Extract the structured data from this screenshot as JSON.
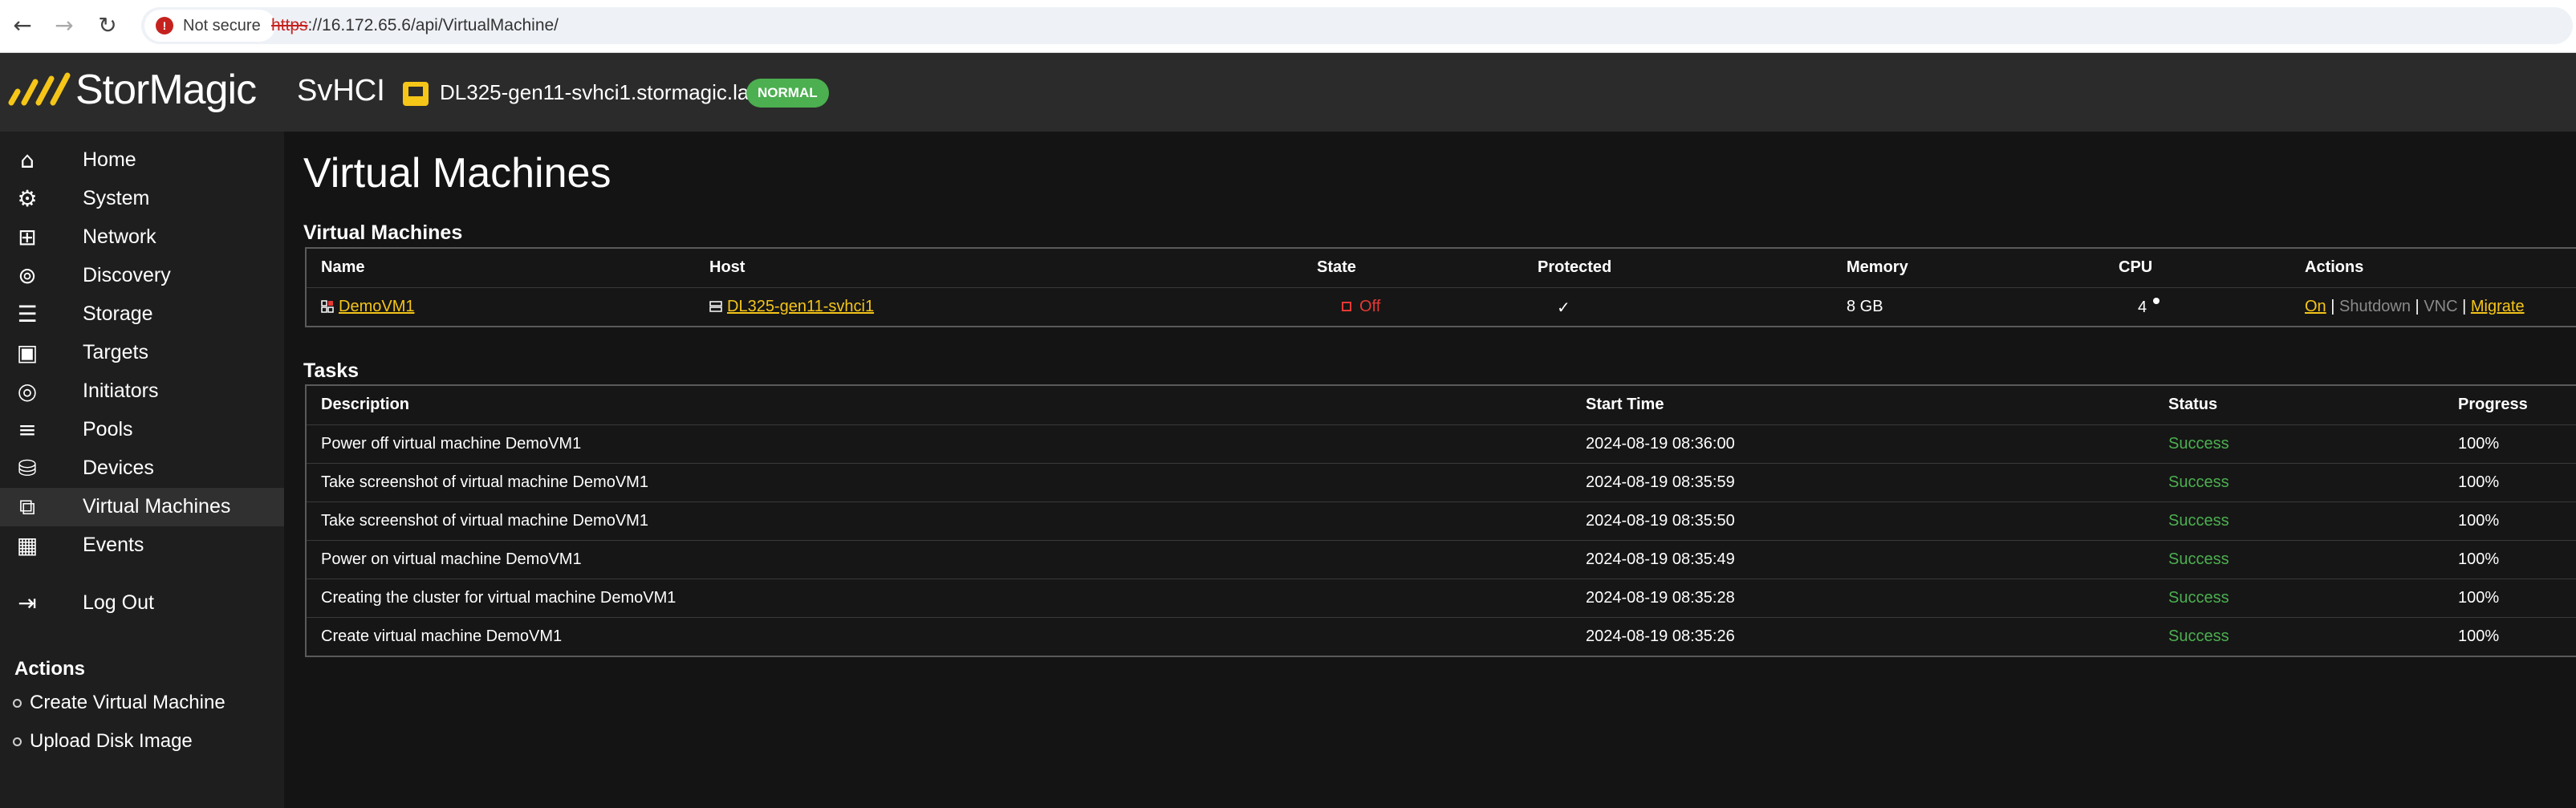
{
  "browser": {
    "back_icon": "arrow-left-icon",
    "forward_icon": "arrow-right-icon",
    "reload_icon": "reload-icon",
    "security_label": "Not secure",
    "url_scheme": "https",
    "url_rest": "://16.172.65.6/api/VirtualMachine/"
  },
  "header": {
    "logo_text": "StorMagic",
    "product": "SvHCI",
    "host_name": "DL325-gen11-svhci1.stormagic.lab",
    "status": "NORMAL",
    "brand_color": "#f5c518",
    "status_color": "#4caf50"
  },
  "sidebar": {
    "items": [
      {
        "label": "Home",
        "icon": "home-icon"
      },
      {
        "label": "System",
        "icon": "system-icon"
      },
      {
        "label": "Network",
        "icon": "network-icon"
      },
      {
        "label": "Discovery",
        "icon": "discovery-icon"
      },
      {
        "label": "Storage",
        "icon": "storage-icon"
      },
      {
        "label": "Targets",
        "icon": "targets-icon"
      },
      {
        "label": "Initiators",
        "icon": "initiators-icon"
      },
      {
        "label": "Pools",
        "icon": "pools-icon"
      },
      {
        "label": "Devices",
        "icon": "devices-icon"
      },
      {
        "label": "Virtual Machines",
        "icon": "virtual-machines-icon",
        "active": true
      },
      {
        "label": "Events",
        "icon": "events-icon"
      },
      {
        "label": "Log Out",
        "icon": "logout-icon"
      }
    ],
    "actions_title": "Actions",
    "actions": [
      "Create Virtual Machine",
      "Upload Disk Image"
    ]
  },
  "main": {
    "title": "Virtual Machines",
    "vm_section_title": "Virtual Machines",
    "vm_columns": [
      "Name",
      "Host",
      "State",
      "Protected",
      "Memory",
      "CPU",
      "Actions"
    ],
    "vm_rows": [
      {
        "name": "DemoVM1",
        "host": "DL325-gen11-svhci1",
        "state": "Off",
        "protected": "✓",
        "memory": "8 GB",
        "cpu": "4",
        "actions": {
          "on": "On",
          "shutdown": "Shutdown",
          "vnc": "VNC",
          "migrate": "Migrate",
          "sep": "|"
        }
      }
    ],
    "tasks_section_title": "Tasks",
    "task_columns": [
      "Description",
      "Start Time",
      "Status",
      "Progress"
    ],
    "task_rows": [
      {
        "description": "Power off virtual machine DemoVM1",
        "start": "2024-08-19 08:36:00",
        "status": "Success",
        "progress": "100%"
      },
      {
        "description": "Take screenshot of virtual machine DemoVM1",
        "start": "2024-08-19 08:35:59",
        "status": "Success",
        "progress": "100%"
      },
      {
        "description": "Take screenshot of virtual machine DemoVM1",
        "start": "2024-08-19 08:35:50",
        "status": "Success",
        "progress": "100%"
      },
      {
        "description": "Power on virtual machine DemoVM1",
        "start": "2024-08-19 08:35:49",
        "status": "Success",
        "progress": "100%"
      },
      {
        "description": "Creating the cluster for virtual machine DemoVM1",
        "start": "2024-08-19 08:35:28",
        "status": "Success",
        "progress": "100%"
      },
      {
        "description": "Create virtual machine DemoVM1",
        "start": "2024-08-19 08:35:26",
        "status": "Success",
        "progress": "100%"
      }
    ]
  }
}
